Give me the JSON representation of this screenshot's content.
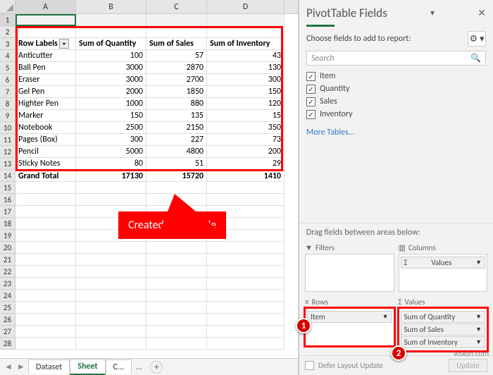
{
  "columns": [
    "A",
    "B",
    "C",
    "D"
  ],
  "pivot": {
    "headers": {
      "rowlabels": "Row Labels",
      "b": "Sum of Quantity",
      "c": "Sum of Sales",
      "d": "Sum of Inventory"
    },
    "rows": [
      {
        "a": "Anticutter",
        "b": "100",
        "c": "57",
        "d": "43"
      },
      {
        "a": "Ball Pen",
        "b": "3000",
        "c": "2870",
        "d": "130"
      },
      {
        "a": "Eraser",
        "b": "3000",
        "c": "2700",
        "d": "300"
      },
      {
        "a": "Gel Pen",
        "b": "2000",
        "c": "1850",
        "d": "150"
      },
      {
        "a": "Highter Pen",
        "b": "1000",
        "c": "880",
        "d": "120"
      },
      {
        "a": "Marker",
        "b": "150",
        "c": "135",
        "d": "15"
      },
      {
        "a": "Notebook",
        "b": "2500",
        "c": "2150",
        "d": "350"
      },
      {
        "a": "Pages (Box)",
        "b": "300",
        "c": "227",
        "d": "73"
      },
      {
        "a": "Pencil",
        "b": "5000",
        "c": "4800",
        "d": "200"
      },
      {
        "a": "Sticky Notes",
        "b": "80",
        "c": "51",
        "d": "29"
      }
    ],
    "total": {
      "label": "Grand Total",
      "b": "17130",
      "c": "15720",
      "d": "1410"
    }
  },
  "callout": "Created Pivot Table",
  "sheet_tabs": {
    "first": "Dataset",
    "active": "Sheet",
    "third": "C..."
  },
  "pane": {
    "title": "PivotTable Fields",
    "choose": "Choose fields to add to report:",
    "search_placeholder": "Search",
    "fields": [
      "Item",
      "Quantity",
      "Sales",
      "Inventory"
    ],
    "more": "More Tables...",
    "drag": "Drag fields between areas below:",
    "filters_label": "Filters",
    "columns_label": "Columns",
    "rows_label": "Rows",
    "values_label": "Values",
    "columns_items": [
      "Values"
    ],
    "rows_items": [
      "Item"
    ],
    "values_items": [
      "Sum of Quantity",
      "Sum of Sales",
      "Sum of Inventory"
    ],
    "defer": "Defer Layout Update",
    "update": "Update"
  },
  "watermark": "wsxdn.com"
}
